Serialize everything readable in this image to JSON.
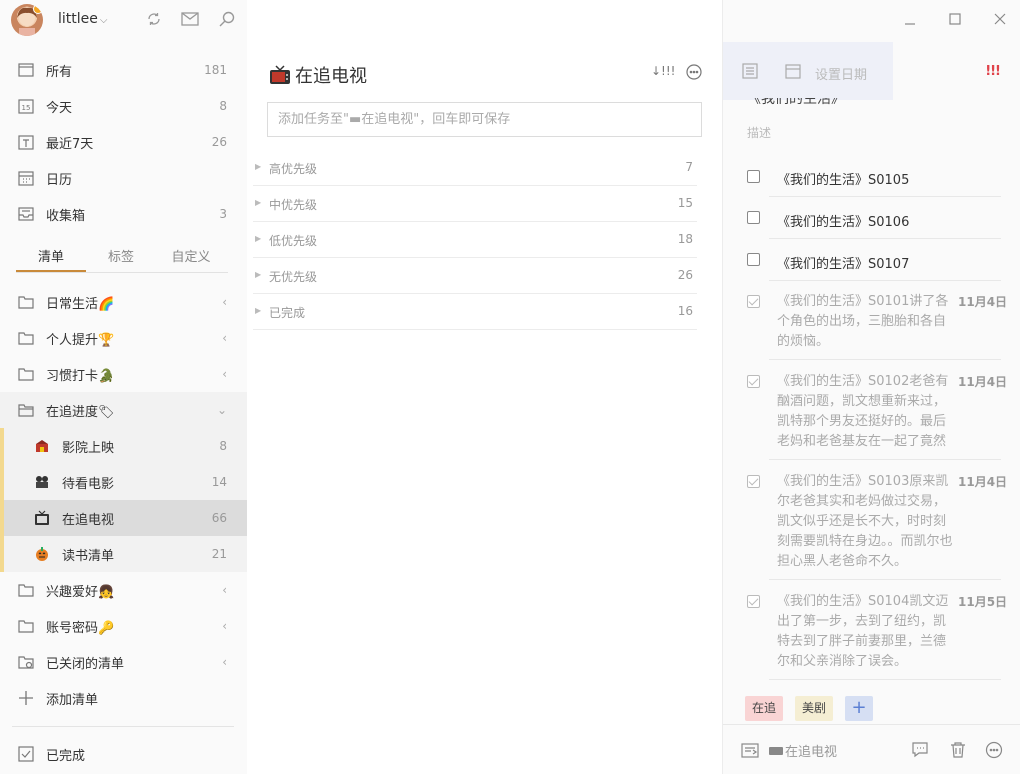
{
  "user": {
    "name": "littlee",
    "caret": "⌵"
  },
  "smart_lists": [
    {
      "id": "all",
      "icon": "inbox-icon",
      "label": "所有",
      "count": "181"
    },
    {
      "id": "today",
      "icon": "calendar-15-icon",
      "label": "今天",
      "count": "8"
    },
    {
      "id": "week",
      "icon": "calendar-t-icon",
      "label": "最近7天",
      "count": "26"
    },
    {
      "id": "calendar",
      "icon": "calendar-grid-icon",
      "label": "日历",
      "count": ""
    },
    {
      "id": "collect",
      "icon": "tray-icon",
      "label": "收集箱",
      "count": "3"
    }
  ],
  "tabs": [
    "清单",
    "标签",
    "自定义"
  ],
  "folders": [
    {
      "label": "日常生活🌈",
      "chev": "‹"
    },
    {
      "label": "个人提升🏆",
      "chev": "‹"
    },
    {
      "label": "习惯打卡🐊",
      "chev": "‹"
    },
    {
      "label": "在追进度🏷",
      "chev": "⌄"
    }
  ],
  "sublists": [
    {
      "label": "影院上映",
      "count": "8"
    },
    {
      "label": "待看电影",
      "count": "14"
    },
    {
      "label": "在追电视",
      "count": "66"
    },
    {
      "label": "读书清单",
      "count": "21"
    }
  ],
  "folders2": [
    {
      "label": "兴趣爱好👧",
      "chev": "‹"
    },
    {
      "label": "账号密码🔑",
      "chev": "‹"
    },
    {
      "label": "已关闭的清单",
      "chev": "‹"
    }
  ],
  "add_list": "添加清单",
  "completed": "已完成",
  "middle": {
    "title": "在追电视",
    "sort_label": "↓!!!",
    "input_placeholder": "添加任务至\"▬在追电视\"，回车即可保存",
    "groups": [
      {
        "label": "高优先级",
        "count": "7"
      },
      {
        "label": "中优先级",
        "count": "15"
      },
      {
        "label": "低优先级",
        "count": "18"
      },
      {
        "label": "无优先级",
        "count": "26"
      },
      {
        "label": "已完成",
        "count": "16"
      }
    ]
  },
  "detail": {
    "set_date": "设置日期",
    "priority_mark": "!!!",
    "title_cut": "《我们的生活》",
    "description_placeholder": "描述",
    "items": [
      {
        "text": "《我们的生活》S0105"
      },
      {
        "text": "《我们的生活》S0106"
      },
      {
        "text": "《我们的生活》S0107"
      }
    ],
    "done_items": [
      {
        "text": "《我们的生活》S0101讲了各个角色的出场，三胞胎和各自的烦恼。",
        "date": "11月4日"
      },
      {
        "text": "《我们的生活》S0102老爸有酗酒问题，凯文想重新来过，凯特那个男友还挺好的。最后老妈和老爸基友在一起了竟然",
        "date": "11月4日"
      },
      {
        "text": "《我们的生活》S0103原来凯尔老爸其实和老妈做过交易，凯文似乎还是长不大，时时刻刻需要凯特在身边。。而凯尔也担心黑人老爸命不久。",
        "date": "11月4日"
      },
      {
        "text": "《我们的生活》S0104凯文迈出了第一步，去到了纽约，凯特去到了胖子前妻那里，兰德尔和父亲消除了误会。",
        "date": "11月5日"
      }
    ],
    "tags": [
      "在追",
      "美剧"
    ],
    "tag_add": "+",
    "list_name": "在追电视"
  },
  "colors": {
    "accent": "#c98a3a",
    "priority": "#e0434a",
    "tag_red": "#f9d4d4",
    "tag_yellow": "#f5eed3",
    "tag_blue": "#d6dff3"
  }
}
